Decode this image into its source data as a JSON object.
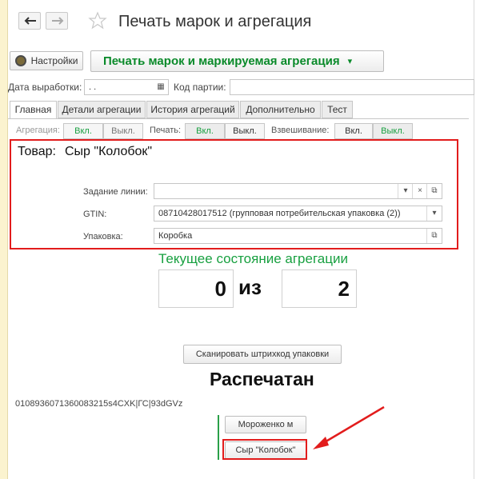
{
  "window": {
    "title": "Печать марок и агрегация"
  },
  "toolbar": {
    "settings_label": "Настройки",
    "main_action_label": "Печать марок и маркируемая агрегация",
    "main_action_arrow": "▾"
  },
  "filters": {
    "date_label": "Дата выработки:",
    "date_value": " .  .",
    "batch_label": "Код партии:",
    "batch_value": ""
  },
  "tabs": [
    {
      "label": "Главная"
    },
    {
      "label": "Детали агрегации"
    },
    {
      "label": "История агрегаций"
    },
    {
      "label": "Дополнительно"
    },
    {
      "label": "Тест"
    }
  ],
  "toggles": {
    "aggregation_label": "Агрегация:",
    "print_label": "Печать:",
    "weighing_label": "Взвешивание:",
    "on": "Вкл.",
    "off": "Выкл."
  },
  "product": {
    "label": "Товар:",
    "name": "Сыр \"Колобок\"",
    "line_task_label": "Задание линии:",
    "line_task_value": "",
    "gtin_label": "GTIN:",
    "gtin_value": "08710428017512 (групповая потребительская упаковка (2))",
    "package_label": "Упаковка:",
    "package_value": "Коробка"
  },
  "aggregation_state": {
    "title": "Текущее состояние агрегации",
    "current": "0",
    "separator": "из",
    "total": "2"
  },
  "scan_button_label": "Сканировать штрихкод упаковки",
  "status_text": "Распечатан",
  "code_text": "0108936071360083215s4CXK|ГС|93dGVz",
  "items": [
    {
      "label": "Мороженко м"
    },
    {
      "label": "Сыр \"Колобок\""
    }
  ],
  "colors": {
    "accent_green": "#18a040",
    "highlight_red": "#e21c1c"
  }
}
